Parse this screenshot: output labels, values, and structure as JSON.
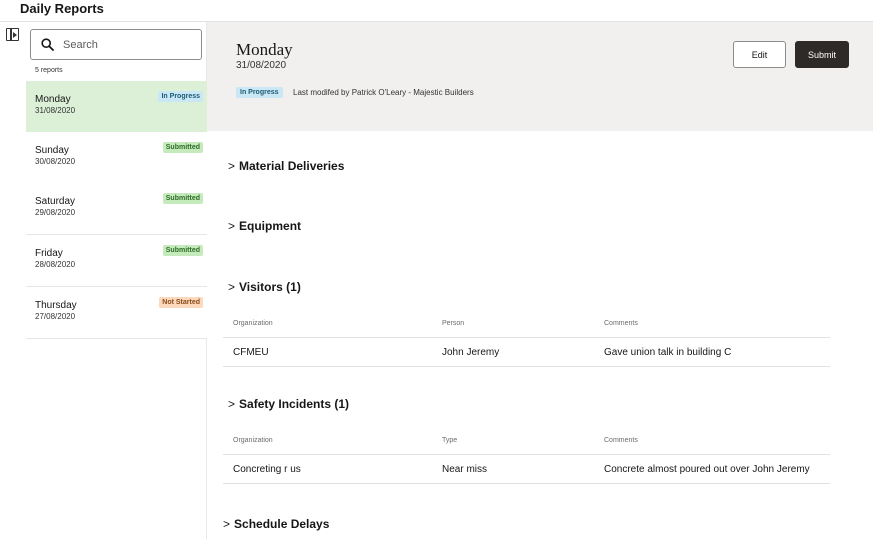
{
  "app": {
    "title": "Daily Reports"
  },
  "sidebar": {
    "search_placeholder": "Search",
    "count": "5 reports",
    "reports": [
      {
        "day": "Monday",
        "date": "31/08/2020",
        "status": "In Progress",
        "active": true
      },
      {
        "day": "Sunday",
        "date": "30/08/2020",
        "status": "Submitted"
      },
      {
        "day": "Saturday",
        "date": "29/08/2020",
        "status": "Submitted"
      },
      {
        "day": "Friday",
        "date": "28/08/2020",
        "status": "Submitted"
      },
      {
        "day": "Thursday",
        "date": "27/08/2020",
        "status": "Not Started"
      }
    ]
  },
  "detail": {
    "title": "Monday",
    "date": "31/08/2020",
    "status": "In Progress",
    "modified": "Last modifed by Patrick O'Leary - Majestic Builders",
    "edit_label": "Edit",
    "submit_label": "Submit",
    "sections": {
      "material": "Material Deliveries",
      "equipment": "Equipment",
      "visitors": "Visitors (1)",
      "safety": "Safety Incidents (1)",
      "delays": "Schedule Delays"
    },
    "visitors_table": {
      "headers": [
        "Organization",
        "Person",
        "Comments"
      ],
      "rows": [
        [
          "CFMEU",
          "John Jeremy",
          "Gave union talk in building C"
        ]
      ]
    },
    "safety_table": {
      "headers": [
        "Organization",
        "Type",
        "Comments"
      ],
      "rows": [
        [
          "Concreting r us",
          "Near miss",
          "Concrete almost poured out over John Jeremy"
        ]
      ]
    }
  }
}
